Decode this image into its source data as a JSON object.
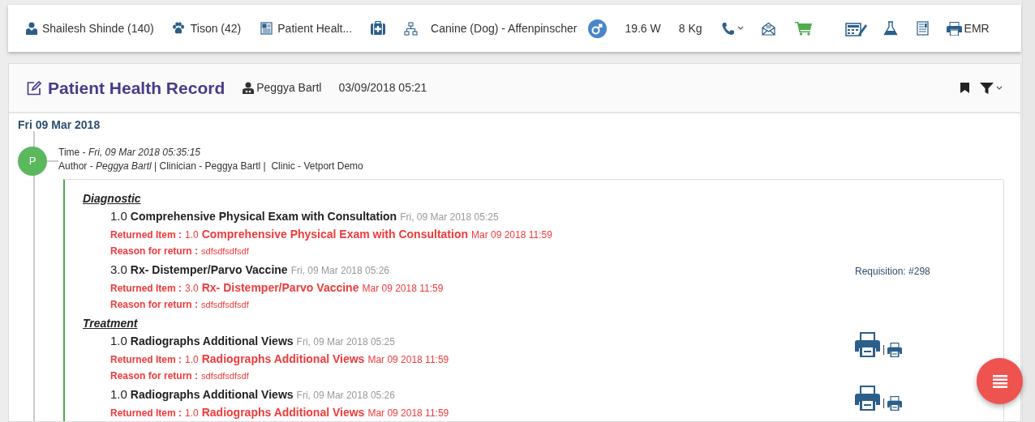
{
  "toolbar": {
    "owner": "Shailesh Shinde (140)",
    "patient": "Tison (42)",
    "record": "Patient Healt...",
    "species": "Canine (Dog) - Affenpinscher",
    "weight_w": "19.6 W",
    "weight_kg": "8 Kg",
    "emr": "EMR"
  },
  "header": {
    "title": "Patient Health Record",
    "author": "Peggya Bartl",
    "datetime": "03/09/2018 05:21"
  },
  "date_group": "Fri 09 Mar 2018",
  "entry": {
    "avatar": "P",
    "color": "#5cb85c",
    "time_line": "Time - *Fri, 09 Mar 2018 05:35:15*",
    "author_line": "Author - *Peggya Bartl* | Clinician - Peggya Bartl |  Clinic - Vetport Demo",
    "sections": [
      {
        "title": "Diagnostic",
        "items": [
          {
            "qty": "1.0",
            "name": "Comprehensive Physical Exam with Consultation",
            "time": "Fri, 09 Mar 2018 05:25",
            "returned": {
              "label": "Returned Item :",
              "qty": "1.0",
              "name": "Comprehensive Physical Exam with Consultation",
              "time": "Mar 09 2018 11:59"
            },
            "reason": {
              "label": "Reason for return :",
              "value": "sdfsdfsdfsdf"
            }
          },
          {
            "qty": "3.0",
            "name": "Rx- Distemper/Parvo Vaccine",
            "time": "Fri, 09 Mar 2018 05:26",
            "returned": {
              "label": "Returned Item :",
              "qty": "3.0",
              "name": "Rx- Distemper/Parvo Vaccine",
              "time": "Mar 09 2018 11:59"
            },
            "reason": {
              "label": "Reason for return :",
              "value": "sdfsdfsdfsdf"
            },
            "side": {
              "kind": "requisition",
              "text": "Requisition: #298"
            }
          }
        ]
      },
      {
        "title": "Treatment",
        "items": [
          {
            "qty": "1.0",
            "name": "Radiographs Additional Views",
            "time": "Fri, 09 Mar 2018 05:25",
            "returned": {
              "label": "Returned Item :",
              "qty": "1.0",
              "name": "Radiographs Additional Views",
              "time": "Mar 09 2018 11:59"
            },
            "reason": {
              "label": "Reason for return :",
              "value": "sdfsdfsdfsdf"
            },
            "side": {
              "kind": "print",
              "separator": "|"
            }
          },
          {
            "qty": "1.0",
            "name": "Radiographs Additional Views",
            "time": "Fri, 09 Mar 2018 05:26",
            "returned": {
              "label": "Returned Item :",
              "qty": "1.0",
              "name": "Radiographs Additional Views",
              "time": "Mar 09 2018 11:59"
            },
            "side": {
              "kind": "print",
              "separator": "|"
            }
          }
        ]
      }
    ]
  }
}
